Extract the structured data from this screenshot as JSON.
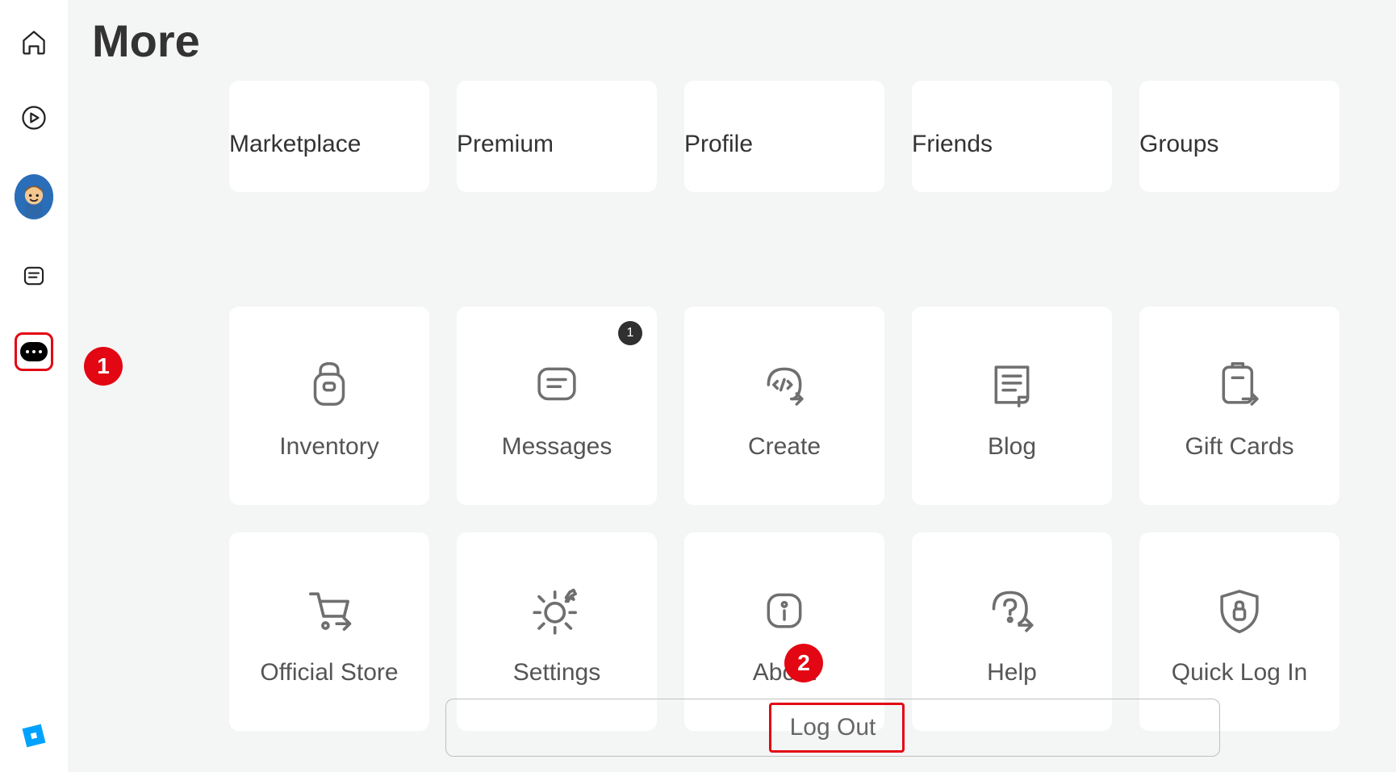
{
  "page": {
    "title": "More"
  },
  "sidebar": {
    "items": [
      "Home",
      "Discover",
      "Avatar",
      "Chat",
      "More"
    ]
  },
  "tiles": {
    "row1": [
      {
        "label": "Marketplace"
      },
      {
        "label": "Premium"
      },
      {
        "label": "Profile"
      },
      {
        "label": "Friends"
      },
      {
        "label": "Groups"
      }
    ],
    "row2": [
      {
        "label": "Inventory"
      },
      {
        "label": "Messages",
        "badge": "1"
      },
      {
        "label": "Create"
      },
      {
        "label": "Blog"
      },
      {
        "label": "Gift Cards"
      }
    ],
    "row3": [
      {
        "label": "Official Store"
      },
      {
        "label": "Settings"
      },
      {
        "label": "About"
      },
      {
        "label": "Help"
      },
      {
        "label": "Quick Log In"
      }
    ]
  },
  "logout": {
    "label": "Log Out"
  },
  "annotations": {
    "one": "1",
    "two": "2"
  }
}
